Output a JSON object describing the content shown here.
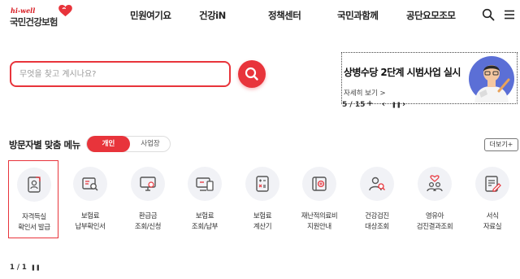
{
  "header": {
    "logo_sub": "hi-well",
    "logo_main": "국민건강보험",
    "nav": [
      "민원여기요",
      "건강iN",
      "정책센터",
      "국민과함께",
      "공단요모조모"
    ],
    "search_icon": "search-icon",
    "menu_icon": "hamburger-menu-icon",
    "brand_color": "#e8343b"
  },
  "search": {
    "placeholder": "무엇을 찾고 계시나요?",
    "value": "",
    "button_icon": "search-icon"
  },
  "banner": {
    "title": "상병수당 2단계 시범사업 실시",
    "link": "자세히 보기 >",
    "page": "5 / 15",
    "add": "+",
    "prev": "‹",
    "pause": "❚❚",
    "next": "›"
  },
  "menu_section": {
    "title": "방문자별 맞춤 메뉴",
    "tabs": [
      "개인",
      "사업장"
    ],
    "active_tab": "개인",
    "more": "더보기+",
    "items": [
      {
        "l1": "자격득실",
        "l2": "확인서 발급",
        "icon": "id-card-icon",
        "selected": true
      },
      {
        "l1": "보험료",
        "l2": "납부확인서",
        "icon": "receipt-search-icon"
      },
      {
        "l1": "환급금",
        "l2": "조회/신청",
        "icon": "monitor-won-icon"
      },
      {
        "l1": "보험료",
        "l2": "조회/납부",
        "icon": "computer-payment-icon"
      },
      {
        "l1": "보험료",
        "l2": "계산기",
        "icon": "calculator-icon"
      },
      {
        "l1": "재난적의료비",
        "l2": "지원안내",
        "icon": "medical-support-icon"
      },
      {
        "l1": "건강검진",
        "l2": "대상조회",
        "icon": "person-search-icon"
      },
      {
        "l1": "영유아",
        "l2": "검진결과조회",
        "icon": "family-heart-icon"
      },
      {
        "l1": "서식",
        "l2": "자료실",
        "icon": "document-form-icon"
      }
    ],
    "page": "1 / 1",
    "pause": "❚❚"
  }
}
